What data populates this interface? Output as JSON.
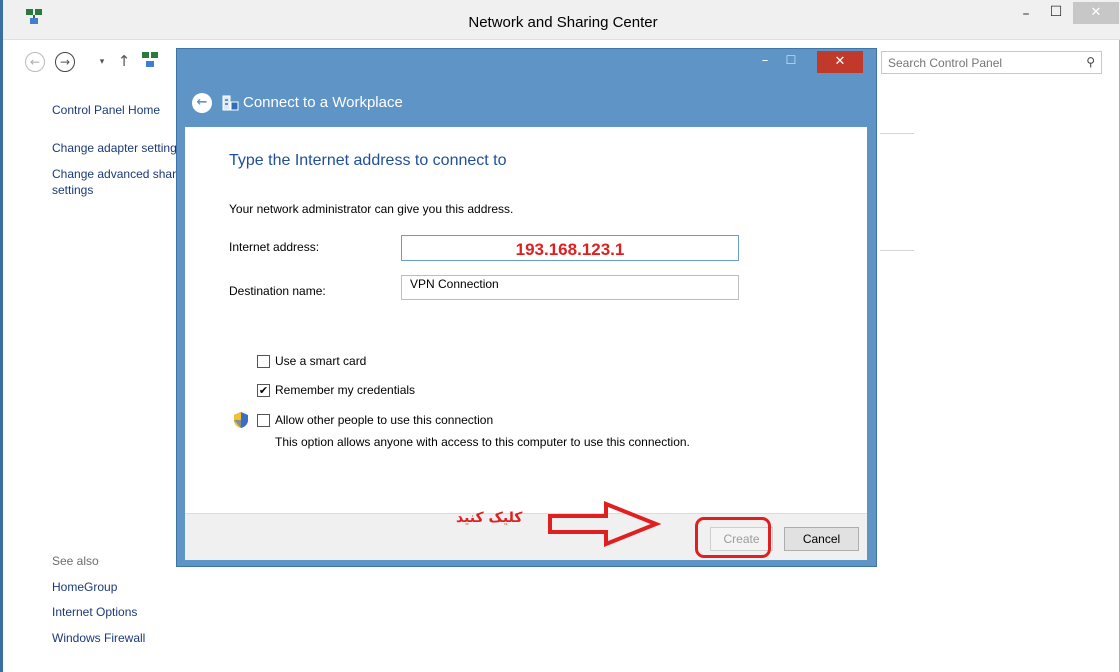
{
  "window": {
    "title": "Network and Sharing Center",
    "minimize": "–",
    "maximize": "☐",
    "close": "✕"
  },
  "address_bar": {
    "back": "←",
    "forward": "→",
    "dropdown": "▾",
    "up": "↑",
    "search_placeholder": "Search Control Panel"
  },
  "sidebar": {
    "control_panel_home": "Control Panel Home",
    "change_adapter": "Change adapter settings",
    "change_advanced_1": "Change advanced sharing",
    "change_advanced_2": "settings",
    "see_also": "See also",
    "homegroup": "HomeGroup",
    "internet_options": "Internet Options",
    "windows_firewall": "Windows Firewall"
  },
  "dialog": {
    "title": "Connect to a Workplace",
    "back": "←",
    "minimize": "–",
    "maximize": "☐",
    "close": "✕",
    "heading": "Type the Internet address to connect to",
    "intro": "Your network administrator can give you this address.",
    "internet_address_label": "Internet address:",
    "internet_address_value": "193.168.123.1",
    "destination_name_label": "Destination name:",
    "destination_name_value": "VPN Connection",
    "options": {
      "smart_card": {
        "label": "Use a smart card",
        "checked": false
      },
      "remember": {
        "label": "Remember my credentials",
        "checked": true
      },
      "allow_others": {
        "label": "Allow other people to use this connection",
        "checked": false
      }
    },
    "allow_others_note": "This option allows anyone with access to this computer to use this connection.",
    "create_button": "Create",
    "cancel_button": "Cancel"
  },
  "annotation": {
    "text": "کلیک کنید",
    "color": "#e02020"
  },
  "check_mark": "✔",
  "colors": {
    "dialog_frame": "#5f94c7",
    "heading": "#1f4f9c",
    "link": "#1a3a78",
    "close_red": "#c0392b"
  }
}
